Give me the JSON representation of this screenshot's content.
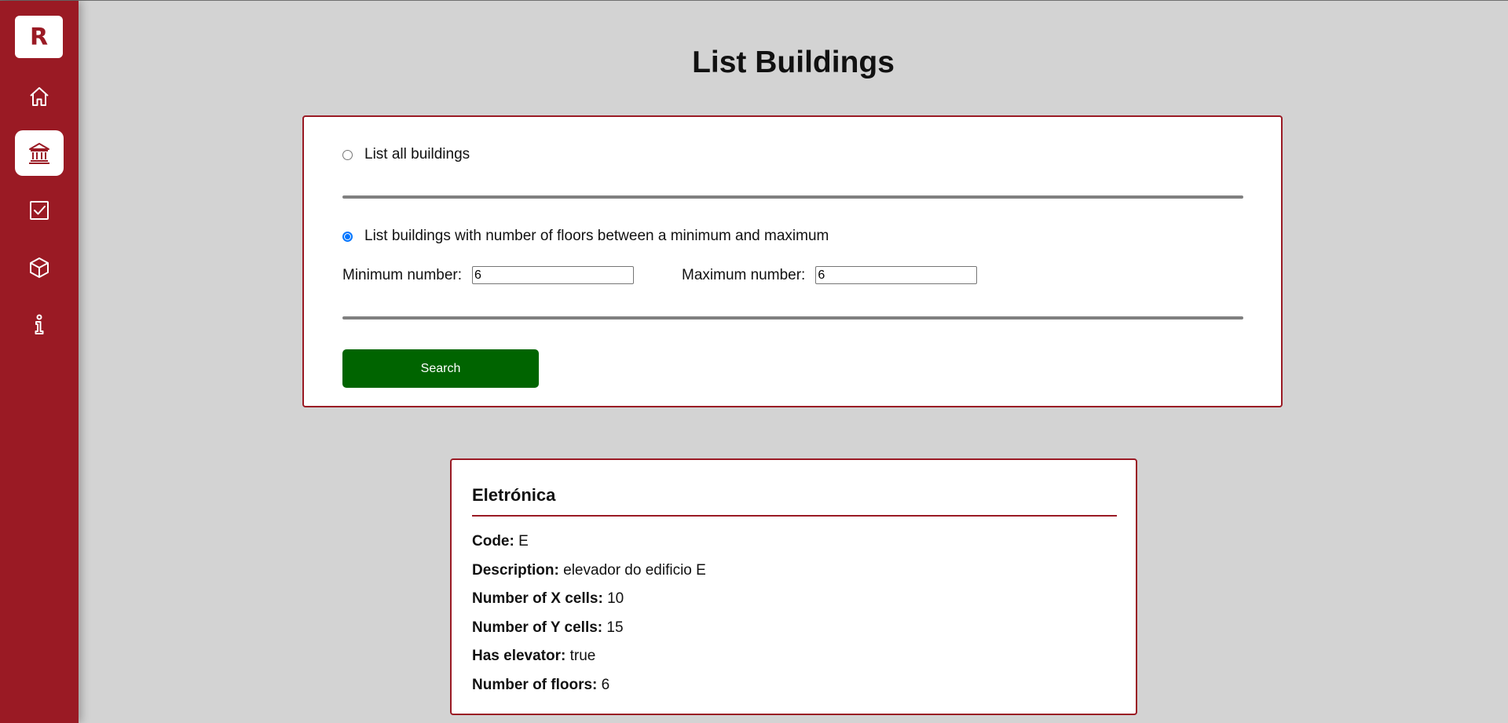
{
  "sidebar": {
    "logo_letter": "R",
    "accent_color": "#9a1a24",
    "items": [
      {
        "icon": "home-icon",
        "active": false
      },
      {
        "icon": "building-icon",
        "active": true
      },
      {
        "icon": "checkbox-icon",
        "active": false
      },
      {
        "icon": "cube-icon",
        "active": false
      },
      {
        "icon": "info-icon",
        "active": false
      }
    ]
  },
  "page": {
    "title": "List Buildings"
  },
  "search": {
    "option_all_label": "List all buildings",
    "option_all_selected": false,
    "option_range_label": "List buildings with number of floors between a minimum and maximum",
    "option_range_selected": true,
    "min_label": "Minimum number:",
    "min_value": "6",
    "max_label": "Maximum number:",
    "max_value": "6",
    "button_label": "Search",
    "button_color": "#006400"
  },
  "results": [
    {
      "name": "Eletrónica",
      "fields": [
        {
          "label": "Code:",
          "value": "E"
        },
        {
          "label": "Description:",
          "value": "elevador do edificio E"
        },
        {
          "label": "Number of X cells:",
          "value": "10"
        },
        {
          "label": "Number of Y cells:",
          "value": "15"
        },
        {
          "label": "Has elevator:",
          "value": "true"
        },
        {
          "label": "Number of floors:",
          "value": "6"
        }
      ]
    }
  ]
}
